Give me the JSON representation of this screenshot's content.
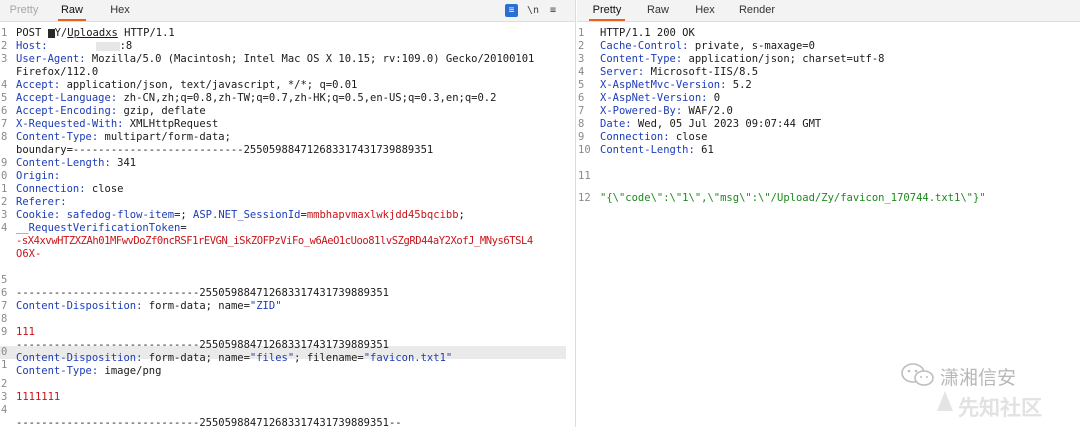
{
  "request_tabs": [
    "Pretty",
    "Raw",
    "Hex"
  ],
  "response_tabs": [
    "Pretty",
    "Raw",
    "Hex",
    "Render"
  ],
  "toolbar": {
    "wrap_glyph": "\\n",
    "menu_glyph": "≡"
  },
  "request": {
    "l1_method": "POST ",
    "l1_path_start": "Y/",
    "l1_path_link": "Uploadxs",
    "l1_proto": " HTTP/1.1",
    "host_key": "Host:",
    "host_val": ":8",
    "ua_key": "User-Agent:",
    "ua_val": " Mozilla/5.0 (Macintosh; Intel Mac OS X 10.15; rv:109.0) Gecko/20100101",
    "ua_cont": "Firefox/112.0",
    "accept_key": "Accept:",
    "accept_val": " application/json, text/javascript, */*; q=0.01",
    "al_key": "Accept-Language:",
    "al_val": " zh-CN,zh;q=0.8,zh-TW;q=0.7,zh-HK;q=0.5,en-US;q=0.3,en;q=0.2",
    "ae_key": "Accept-Encoding:",
    "ae_val": " gzip, deflate",
    "xrw_key": "X-Requested-With:",
    "xrw_val": " XMLHttpRequest",
    "ct_key": "Content-Type:",
    "ct_val": " multipart/form-data;",
    "ct_cont": "boundary=---------------------------255059884712683317431739889351",
    "cl_key": "Content-Length:",
    "cl_val": " 341",
    "origin_key": "Origin:",
    "conn_key": "Connection:",
    "conn_val": " close",
    "ref_key": "Referer:",
    "cookie_key": "Cookie:",
    "cookie_name1": " safedog-flow-item",
    "cookie_eq1": "=; ",
    "cookie_name2": "ASP.NET_SessionId",
    "cookie_eq2": "=",
    "cookie_val2": "mmbhapvmaxlwkjdd45bqcibb",
    "cookie_sep": ";",
    "cookie_name3": "__RequestVerificationToken",
    "cookie_eq3": "=",
    "cookie_val3": "-sX4xvwHTZXZAh01MFwvDoZf0ncRSF1rEVGN_iSkZOFPzViFo_w6AeO1cUoo81lvSZgRD44aY2XofJ_MNys6TSL4",
    "cookie_val3b": "O6X-",
    "boundary": "-----------------------------255059884712683317431739889351",
    "cd1_key": "Content-Disposition:",
    "cd1_val1": " form-data; name=",
    "cd1_val2": "\"ZID\"",
    "zid_value": "111",
    "cd2_key": "Content-Disposition:",
    "cd2_val1": " form-data; name=",
    "cd2_val2": "\"files\"",
    "cd2_val3": "; filename=",
    "cd2_val4": "\"favicon.txt1\"",
    "ct2_key": "Content-Type:",
    "ct2_val": " image/png",
    "file_content": "1111111",
    "boundary_end": "-----------------------------255059884712683317431739889351--"
  },
  "request_line_numbers": [
    "1",
    "2",
    "3",
    "",
    "4",
    "5",
    "6",
    "7",
    "8",
    "",
    "9",
    "0",
    "1",
    "2",
    "3",
    "4",
    "",
    "",
    "",
    "5",
    "6",
    "7",
    "8",
    "9",
    "0",
    "1",
    "2",
    "3",
    "4"
  ],
  "response": {
    "l1": "HTTP/1.1 200 OK",
    "cc_key": "Cache-Control:",
    "cc_val": " private, s-maxage=0",
    "ct_key": "Content-Type:",
    "ct_val": " application/json; charset=utf-8",
    "srv_key": "Server:",
    "srv_val": " Microsoft-IIS/8.5",
    "mvc_key": "X-AspNetMvc-Version:",
    "mvc_val": " 5.2",
    "net_key": "X-AspNet-Version:",
    "net_val": " 0",
    "pb_key": "X-Powered-By:",
    "pb_val": " WAF/2.0",
    "date_key": "Date:",
    "date_val": " Wed, 05 Jul 2023 09:07:44 GMT",
    "conn_key": "Connection:",
    "conn_val": " close",
    "cl_key": "Content-Length:",
    "cl_val": " 61",
    "body": "\"{\\\"code\\\":\\\"1\\\",\\\"msg\\\":\\\"/Upload/Zy/favicon_170744.txt1\\\"}\""
  },
  "response_line_numbers": [
    "1",
    "2",
    "3",
    "4",
    "5",
    "6",
    "7",
    "8",
    "9",
    "10",
    "11",
    "12"
  ],
  "watermark": {
    "top": "潇湘信安",
    "bottom": "先知社区"
  },
  "colors": {
    "header_key": "#1d3cb8",
    "cookie_value": "#c8141a",
    "json_body": "#1c8a1c",
    "active_tab": "#e8621f"
  }
}
